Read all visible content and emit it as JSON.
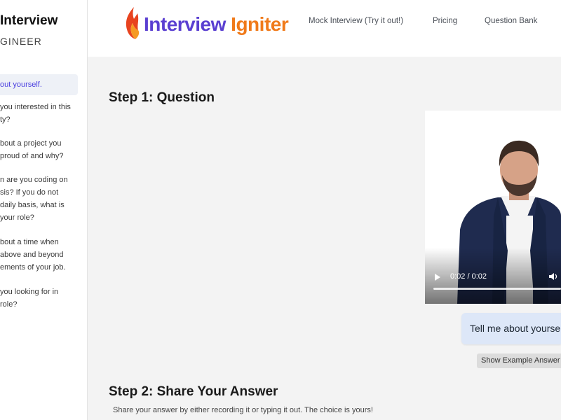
{
  "sidebar": {
    "title": "Interview",
    "subtitle": "GINEER",
    "items": [
      {
        "lines": [
          "out yourself."
        ],
        "active": true
      },
      {
        "lines": [
          "you interested in this",
          "ty?"
        ],
        "active": false
      },
      {
        "lines": [
          "bout a project you",
          "proud of and why?"
        ],
        "active": false
      },
      {
        "lines": [
          "n are you coding on",
          "sis? If you do not",
          "daily basis, what is",
          "your role?"
        ],
        "active": false
      },
      {
        "lines": [
          "bout a time when",
          "above and beyond",
          "ements of your job."
        ],
        "active": false
      },
      {
        "lines": [
          "you looking for in",
          "role?"
        ],
        "active": false
      }
    ]
  },
  "header": {
    "logo_word1": "Interview",
    "logo_word2": "Igniter",
    "nav": [
      "Mock Interview (Try it out!)",
      "Pricing",
      "Question Bank"
    ]
  },
  "main": {
    "step1_title": "Step 1: Question",
    "video": {
      "time": "0:02 / 0:02",
      "progress": 1.0
    },
    "question_bubble": "Tell me about yourse",
    "example_button": "Show Example Answer",
    "step2_title": "Step 2: Share Your Answer",
    "step2_desc": "Share your answer by either recording it or typing it out. The choice is yours!"
  },
  "colors": {
    "logo_purple": "#5a3fd1",
    "logo_orange": "#f07a1a",
    "active_item": "#4a3fe0",
    "bubble_bg": "#dde7f8"
  }
}
